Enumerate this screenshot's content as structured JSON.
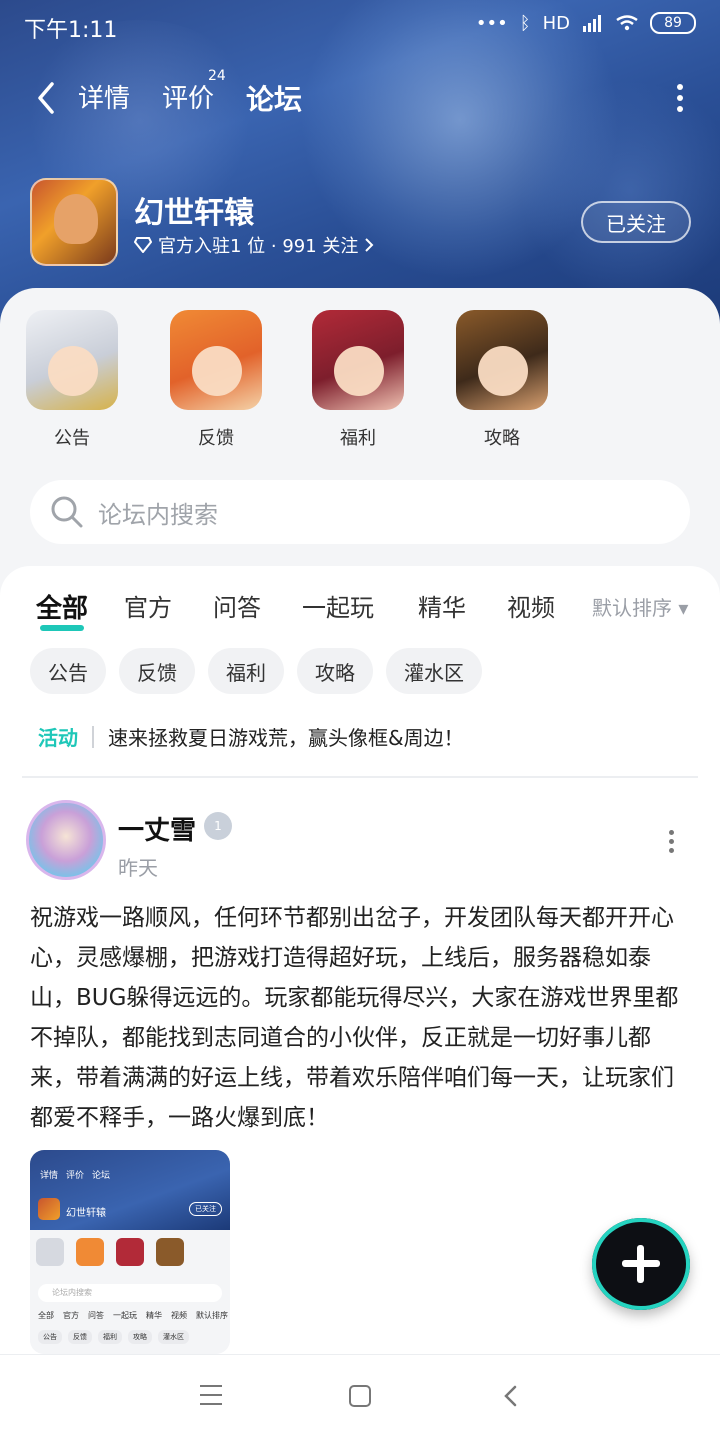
{
  "status_bar": {
    "time": "下午1:11",
    "network": "HD",
    "battery": "89"
  },
  "nav": {
    "tabs": [
      {
        "label": "详情"
      },
      {
        "label": "评价",
        "badge": "24"
      },
      {
        "label": "论坛"
      }
    ]
  },
  "game": {
    "title": "幻世轩辕",
    "subtitle": "官方入驻1 位 · 991 关注",
    "follow_label": "已关注"
  },
  "quick_links": [
    {
      "label": "公告"
    },
    {
      "label": "反馈"
    },
    {
      "label": "福利"
    },
    {
      "label": "攻略"
    }
  ],
  "search": {
    "placeholder": "论坛内搜索"
  },
  "filters": {
    "tabs": [
      "全部",
      "官方",
      "问答",
      "一起玩",
      "精华",
      "视频"
    ],
    "sort": "默认排序 ▾"
  },
  "chips": [
    "公告",
    "反馈",
    "福利",
    "攻略",
    "灌水区"
  ],
  "activity": {
    "tag": "活动",
    "text": "速来拯救夏日游戏荒，赢头像框&周边！"
  },
  "post": {
    "author": "一丈雪",
    "badge": "1",
    "time": "昨天",
    "body": "祝游戏一路顺风，任何环节都别出岔子，开发团队每天都开开心心，灵感爆棚，把游戏打造得超好玩，上线后，服务器稳如泰山，BUG躲得远远的。玩家都能玩得尽兴，大家在游戏世界里都不掉队，都能找到志同道合的小伙伴，反正就是一切好事儿都来，带着满满的好运上线，带着欢乐陪伴咱们每一天，让玩家们都爱不释手，一路火爆到底！"
  },
  "thumbnail": {
    "nav": [
      "详情",
      "评价",
      "论坛"
    ],
    "title": "幻世轩辕",
    "follow": "已关注",
    "search": "论坛内搜索",
    "tabs": [
      "全部",
      "官方",
      "问答",
      "一起玩",
      "精华",
      "视频",
      "默认排序"
    ],
    "chips": [
      "公告",
      "反馈",
      "福利",
      "攻略",
      "灌水区"
    ]
  },
  "colors": {
    "accent": "#1ec7b8",
    "banner": "#2c4a8c"
  }
}
